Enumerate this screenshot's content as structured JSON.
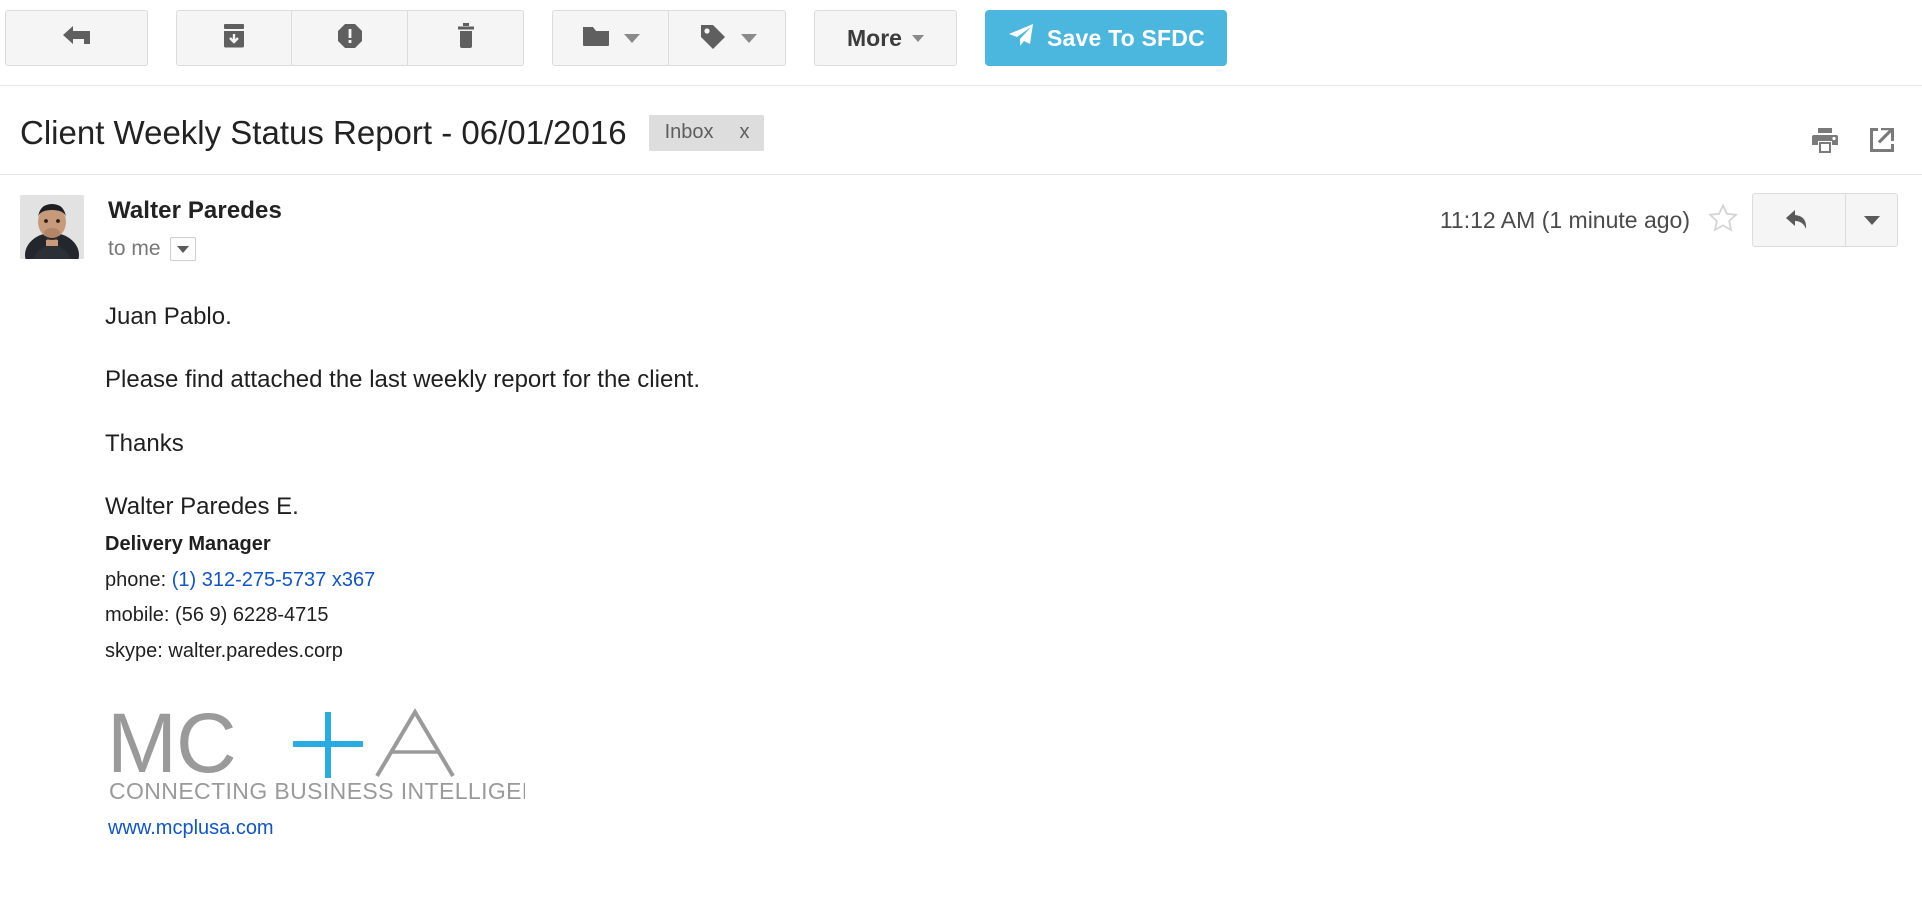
{
  "toolbar": {
    "buttons": [
      {
        "name": "back-button",
        "icon": "back-arrow-icon",
        "label": ""
      },
      {
        "name": "archive-button",
        "icon": "archive-icon",
        "label": ""
      },
      {
        "name": "spam-button",
        "icon": "report-spam-icon",
        "label": ""
      },
      {
        "name": "delete-button",
        "icon": "trash-icon",
        "label": ""
      },
      {
        "name": "move-to-button",
        "icon": "folder-icon",
        "label": ""
      },
      {
        "name": "labels-button",
        "icon": "tag-icon",
        "label": ""
      }
    ],
    "more_label": "More",
    "sfdc_label": "Save To SFDC",
    "sfdc_icon": "paper-plane-icon",
    "sfdc_color": "#4cb7de"
  },
  "subject": {
    "title": "Client Weekly Status Report - 06/01/2016",
    "label_chip": "Inbox",
    "label_chip_remove": "x",
    "print_icon": "printer-icon",
    "popout_icon": "open-in-new-window-icon"
  },
  "message": {
    "sender_name": "Walter Paredes",
    "recipient_line": "to me",
    "timestamp": "11:12 AM (1 minute ago)",
    "star_icon": "star-outline-icon",
    "reply_icon": "reply-arrow-icon",
    "more_options_icon": "chevron-down-icon",
    "details_caret_icon": "chevron-down-icon",
    "avatar": "sender-avatar-photo",
    "body": [
      "Juan Pablo.",
      "Please find attached the last weekly report for the client.",
      "Thanks"
    ],
    "signature": {
      "name": "Walter Paredes E.",
      "title": "Delivery Manager",
      "phone_label": "phone:",
      "phone_value": "(1) 312-275-5737  x367",
      "mobile_label": "mobile:",
      "mobile_value": "(56 9) 6228-4715",
      "skype_label": "skype:",
      "skype_value": "walter.paredes.corp"
    },
    "logo": {
      "mark_mc": "MC",
      "mark_plus": "+",
      "mark_a": "A",
      "tagline": "CONNECTING BUSINESS INTELLIGENCE",
      "url": "www.mcplusa.com",
      "grey": "#8f8f8f",
      "cyan": "#29ace3",
      "link_blue": "#1155cc"
    }
  }
}
